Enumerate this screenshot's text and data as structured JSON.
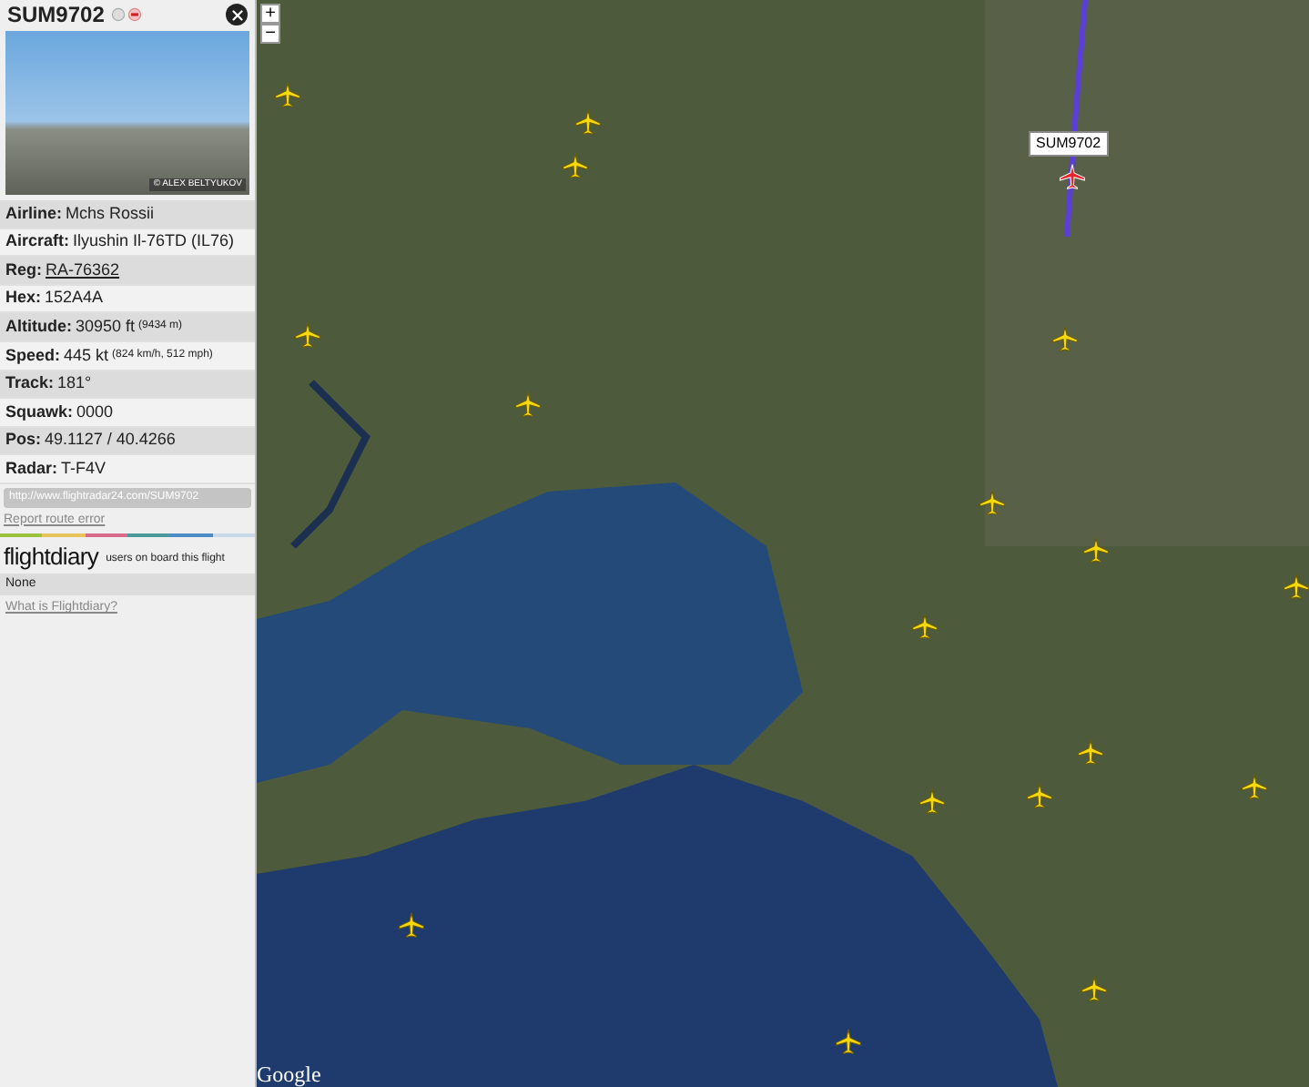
{
  "panel": {
    "callsign": "SUM9702",
    "photo_credit": "© ALEX BELTYUKOV",
    "rows": [
      {
        "label": "Airline:",
        "value": "Mchs Rossii",
        "link": false
      },
      {
        "label": "Aircraft:",
        "value": "Ilyushin Il-76TD (IL76)",
        "link": false
      },
      {
        "label": "Reg:",
        "value": "RA-76362",
        "link": true
      },
      {
        "label": "Hex:",
        "value": "152A4A",
        "link": false
      },
      {
        "label": "Altitude:",
        "value": "30950 ft",
        "detail": "(9434 m)",
        "link": false
      },
      {
        "label": "Speed:",
        "value": "445 kt",
        "detail": "(824 km/h, 512 mph)",
        "link": false
      },
      {
        "label": "Track:",
        "value": "181°",
        "link": false
      },
      {
        "label": "Squawk:",
        "value": "0000",
        "link": false
      },
      {
        "label": "Pos:",
        "value": "49.1127 / 40.4266",
        "link": false
      },
      {
        "label": "Radar:",
        "value": "T-F4V",
        "link": false
      }
    ],
    "url": "http://www.flightradar24.com/SUM9702",
    "report_link": "Report route error",
    "flightdiary": {
      "logo": "flightdiary",
      "caption": "users on board this flight",
      "value": "None",
      "link": "What is Flightdiary?"
    }
  },
  "map": {
    "zoom_in": "+",
    "zoom_out": "−",
    "flight_label": "SUM9702",
    "logo": "Google"
  }
}
